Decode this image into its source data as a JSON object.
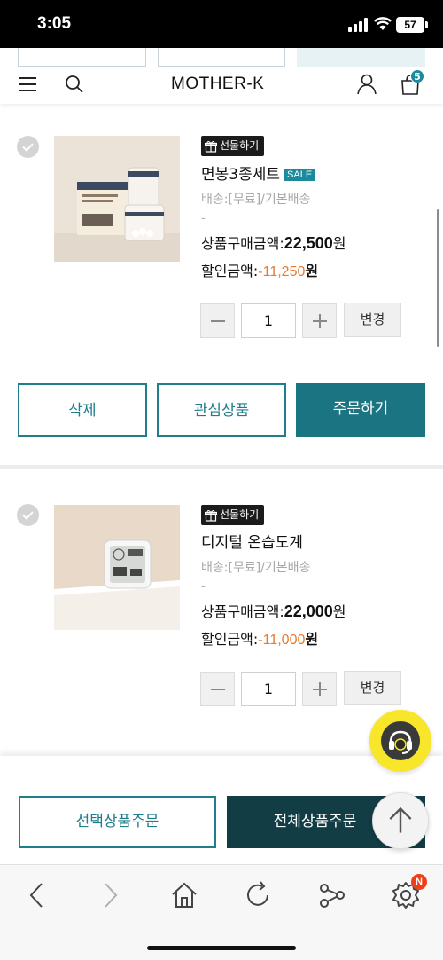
{
  "status_bar": {
    "time": "3:05",
    "battery": "57"
  },
  "header": {
    "logo": "MOTHER-K",
    "cart_count": "5"
  },
  "products": [
    {
      "gift_label": "선물하기",
      "name": "면봉3종세트",
      "sale_badge": "SALE",
      "shipping": "배송:[무료]/기본배송",
      "dash": "-",
      "price_label": "상품구매금액:",
      "price_amount": "22,500",
      "price_unit": "원",
      "discount_label": "할인금액:",
      "discount_amount": "-11,250",
      "discount_unit": "원",
      "quantity": "1",
      "change_label": "변경"
    },
    {
      "gift_label": "선물하기",
      "name": "디지털 온습도계",
      "shipping": "배송:[무료]/기본배송",
      "dash": "-",
      "price_label": "상품구매금액:",
      "price_amount": "22,000",
      "price_unit": "원",
      "discount_label": "할인금액:",
      "discount_amount": "-11,000",
      "discount_unit": "원",
      "quantity": "1",
      "change_label": "변경"
    }
  ],
  "actions": {
    "delete": "삭제",
    "wishlist": "관심상품",
    "order": "주문하기"
  },
  "order_bar": {
    "order_selected": "선택상품주문",
    "order_all": "전체상품주문"
  },
  "colors": {
    "accent": "#1f7d8c",
    "dark_accent": "#133d45",
    "discount": "#e87a2d",
    "chat": "#f7e62a",
    "badge": "#ef3e1a"
  }
}
